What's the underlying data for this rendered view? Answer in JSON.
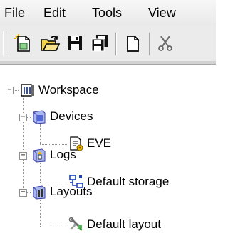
{
  "menu": [
    "File",
    "Edit",
    "Tools",
    "View"
  ],
  "toolbar": {
    "buttons": [
      "new-project-icon",
      "open-folder-icon",
      "save-icon",
      "save-all-icon",
      "new-document-icon"
    ]
  },
  "tree": {
    "root": {
      "label": "Workspace",
      "expander": "−"
    },
    "devices": {
      "label": "Devices",
      "expander": "−",
      "children": [
        "EVE"
      ]
    },
    "logs": {
      "label": "Logs",
      "expander": "−",
      "children": [
        "Default storage"
      ]
    },
    "layouts": {
      "label": "Layouts",
      "expander": "−",
      "children": [
        "Default layout"
      ]
    }
  }
}
